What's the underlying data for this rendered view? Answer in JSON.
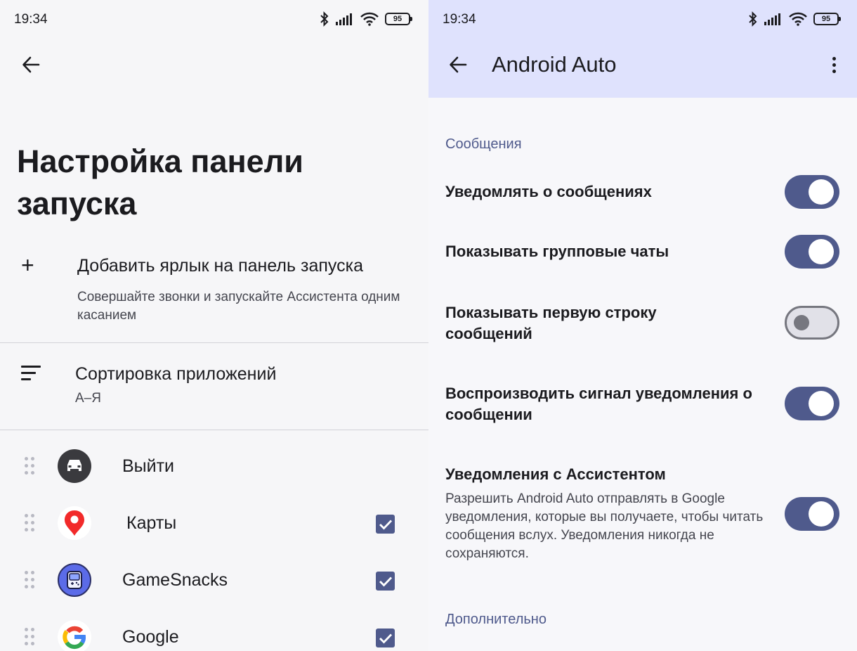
{
  "left_screen": {
    "status": {
      "time": "19:34",
      "battery": "95"
    },
    "title": "Настройка панели запуска",
    "add_shortcut": {
      "title": "Добавить ярлык на панель запуска",
      "subtitle": "Совершайте звонки и запускайте Ассистента одним касанием"
    },
    "sort": {
      "title": "Сортировка приложений",
      "value": "А–Я"
    },
    "apps": [
      {
        "name": "Выйти",
        "icon": "car-icon",
        "checked": null
      },
      {
        "name": "Карты",
        "icon": "maps-pin-icon",
        "checked": true
      },
      {
        "name": "GameSnacks",
        "icon": "gamesnacks-icon",
        "checked": true
      },
      {
        "name": "Google",
        "icon": "google-g-icon",
        "checked": true
      }
    ]
  },
  "right_screen": {
    "status": {
      "time": "19:34",
      "battery": "95"
    },
    "title": "Android Auto",
    "section_messages": "Сообщения",
    "settings": [
      {
        "title": "Уведомлять о сообщениях",
        "description": "",
        "enabled": true
      },
      {
        "title": "Показывать групповые чаты",
        "description": "",
        "enabled": true
      },
      {
        "title": "Показывать первую строку сообщений",
        "description": "",
        "enabled": false
      },
      {
        "title": "Воспроизводить сигнал уведомления о сообщении",
        "description": "",
        "enabled": true
      },
      {
        "title": "Уведомления с Ассистентом",
        "description": "Разрешить Android Auto отправлять в Google уведомления, которые вы получаете, чтобы читать сообщения вслух. Уведомления никогда не сохраняются.",
        "enabled": true
      }
    ],
    "section_more": "Дополнительно"
  },
  "colors": {
    "accent": "#4f5a8c",
    "topbar": "#dfe2fd",
    "section_header": "#4f5a8c"
  }
}
